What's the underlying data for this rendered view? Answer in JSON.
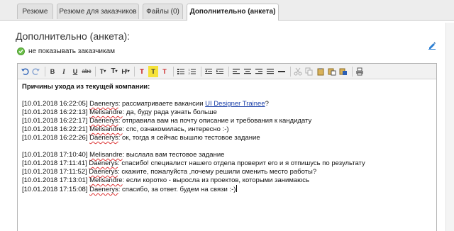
{
  "tabs": [
    {
      "label": "Резюме"
    },
    {
      "label": "Резюме для заказчиков"
    },
    {
      "label": "Файлы (0)"
    },
    {
      "label": "Дополнительно (анкета)"
    }
  ],
  "section": {
    "title": "Дополнительно (анкета):",
    "hide_label": "не показывать заказчикам"
  },
  "toolbar": {
    "font_size_label": "T",
    "heading_label": "H"
  },
  "editor": {
    "heading": "Причины ухода из текущей компании:",
    "block1": [
      {
        "ts": "[10.01.2018 16:22:05]",
        "name": "Daenerys",
        "text": ": рассматриваете вакансии ",
        "link": "UI Designer Trainee",
        "tail": "?"
      },
      {
        "ts": "[10.01.2018 16:22:13]",
        "name": "Melisandre",
        "text": ": да, буду рада узнать больше"
      },
      {
        "ts": "[10.01.2018 16:22:17]",
        "name": "Daenerys",
        "text": ": отправила вам на почту описание и требования к кандидату"
      },
      {
        "ts": "[10.01.2018 16:22:21]",
        "name": "Melisandre",
        "text": ": спс, ознакомилась, интересно :-)"
      },
      {
        "ts": "[10.01.2018 16:22:26]",
        "name": "Daenerys",
        "text": ": ок, тогда я сейчас вышлю тестовое задание"
      }
    ],
    "block2": [
      {
        "ts": "[10.01.2018 17:10:40]",
        "name": "Melisandre",
        "text": ": выслала вам тестовое задание"
      },
      {
        "ts": "[10.01.2018 17:11:41]",
        "name": "Daenerys",
        "text": ": спасибо! специалист нашего отдела проверит его и я отпишусь по результату"
      },
      {
        "ts": "[10.01.2018 17:11:52]",
        "name": "Daenerys",
        "text": ": скажите, пожалуйста ,почему решили сменить место работы?"
      },
      {
        "ts": "[10.01.2018 17:13:01]",
        "name": "Melisandre",
        "text": ": если коротко - выросла из проектов, которыми занимаюсь"
      },
      {
        "ts": "[10.01.2018 17:15:08]",
        "name": "Daenerys",
        "text": ": спасибо, за ответ. будем на связи :-)"
      }
    ]
  },
  "colors": {
    "accent_green": "#6cc04a",
    "link_blue": "#1a3fa8",
    "edit_icon_blue": "#2a7fd4"
  }
}
